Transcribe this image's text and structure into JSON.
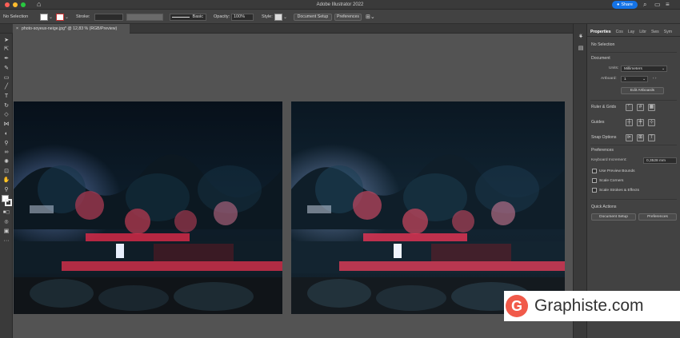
{
  "app": {
    "title": "Adobe Illustrator 2022",
    "share_label": "Share"
  },
  "controlbar": {
    "selection": "No Selection",
    "stroke_label": "Stroke:",
    "brush_label": "Basic",
    "opacity_label": "Opacity:",
    "opacity_value": "100%",
    "style_label": "Style:",
    "document_setup": "Document Setup",
    "preferences": "Preferences"
  },
  "document": {
    "tab_title": "photo-soyeux-neige.jpg* @ 12,83 % (RGB/Preview)",
    "close": "×"
  },
  "panel": {
    "tabs": [
      "Properties",
      "Cos",
      "Lay",
      "Libr",
      "Sws",
      "Sym"
    ],
    "selection_state": "No Selection",
    "document_heading": "Document",
    "units_label": "Units:",
    "units_value": "Millimeters",
    "artboard_label": "Artboard:",
    "artboard_value": "1",
    "edit_artboards": "Edit Artboards",
    "rulers_grids": "Ruler & Grids",
    "guides": "Guides",
    "snap_options": "Snap Options",
    "preferences_heading": "Preferences",
    "keyboard_increment_label": "Keyboard Increment:",
    "keyboard_increment_value": "0,3528 mm",
    "use_preview_bounds": "Use Preview Bounds",
    "scale_corners": "Scale Corners",
    "scale_strokes": "Scale Strokes & Effects",
    "quick_actions": "Quick Actions",
    "qa_document_setup": "Document Setup",
    "qa_preferences": "Preferences"
  },
  "watermark": {
    "logo_letter": "G",
    "text": "Graphiste.com"
  },
  "colors": {
    "accent": "#1473e6",
    "brand": "#f15a4a",
    "panel_bg": "#424242",
    "canvas_bg": "#535353"
  }
}
